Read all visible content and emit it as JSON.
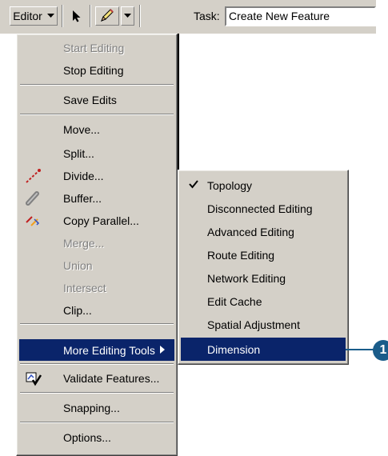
{
  "toolbar": {
    "editor_label": "Editor",
    "task_label": "Task:",
    "task_value": "Create New Feature"
  },
  "editor_menu": {
    "items": [
      {
        "label": "Start Editing",
        "disabled": true
      },
      {
        "label": "Stop Editing"
      },
      {
        "label": "Save Edits"
      },
      {
        "label": "Move..."
      },
      {
        "label": "Split..."
      },
      {
        "label": "Divide...",
        "icon": "divide-icon"
      },
      {
        "label": "Buffer...",
        "icon": "buffer-icon"
      },
      {
        "label": "Copy Parallel...",
        "icon": "copy-parallel-icon"
      },
      {
        "label": "Merge...",
        "disabled": true
      },
      {
        "label": "Union",
        "disabled": true
      },
      {
        "label": "Intersect",
        "disabled": true
      },
      {
        "label": "Clip..."
      },
      {
        "label": "More Editing Tools",
        "highlighted": true,
        "has_submenu": true
      },
      {
        "label": "Validate Features...",
        "icon": "validate-features-icon"
      },
      {
        "label": "Snapping..."
      },
      {
        "label": "Options..."
      }
    ]
  },
  "submenu": {
    "items": [
      {
        "label": "Topology",
        "checked": true
      },
      {
        "label": "Disconnected Editing"
      },
      {
        "label": "Advanced Editing"
      },
      {
        "label": "Route Editing"
      },
      {
        "label": "Network Editing"
      },
      {
        "label": "Edit Cache"
      },
      {
        "label": "Spatial Adjustment"
      },
      {
        "label": "Dimension",
        "highlighted": true
      }
    ]
  },
  "callout": {
    "number": "1",
    "color": "#1a5c8a"
  },
  "colors": {
    "menu_bg": "#d4d0c8",
    "highlight": "#0a246a"
  }
}
